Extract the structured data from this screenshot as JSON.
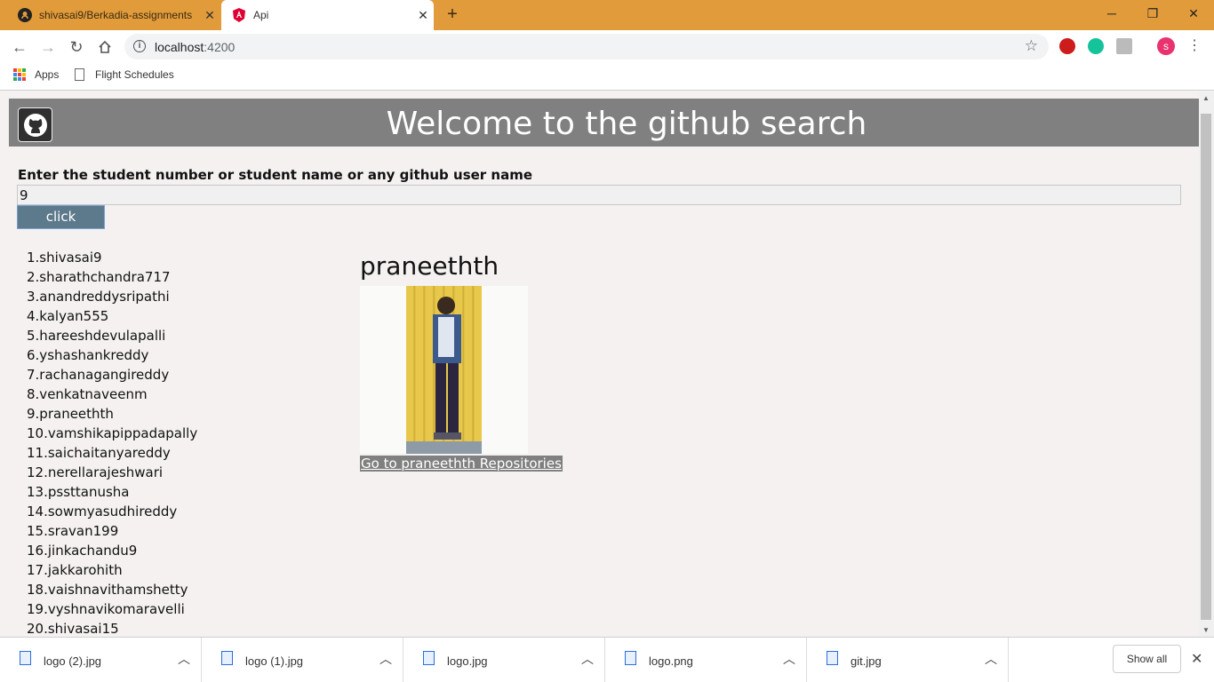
{
  "browser": {
    "tabs": [
      {
        "title": "shivasai9/Berkadia-assignments",
        "icon": "github-icon",
        "active": false
      },
      {
        "title": "Api",
        "icon": "angular-icon",
        "active": true
      }
    ],
    "new_tab": "+",
    "window_controls": {
      "minimize": "─",
      "restore": "❐",
      "close": "✕"
    },
    "url_host": "localhost",
    "url_port": ":4200",
    "profile_initial": "s",
    "bookmarks": [
      {
        "label": "Apps",
        "icon": "apps-grid-icon"
      },
      {
        "label": "Flight Schedules",
        "icon": "document-icon"
      }
    ]
  },
  "page": {
    "banner_title": "Welcome to the github search",
    "prompt_label": "Enter the student number or student name or any github user name",
    "search_value": "9",
    "button_label": "click",
    "students": [
      "1.shivasai9",
      "2.sharathchandra717",
      "3.anandreddysripathi",
      "4.kalyan555",
      "5.hareeshdevulapalli",
      "6.yshashankreddy",
      "7.rachanagangireddy",
      "8.venkatnaveenm",
      "9.praneethth",
      "10.vamshikapippadapally",
      "11.saichaitanyareddy",
      "12.nerellarajeshwari",
      "13.pssttanusha",
      "14.sowmyasudhireddy",
      "15.sravan199",
      "16.jinkachandu9",
      "17.jakkarohith",
      "18.vaishnavithamshetty",
      "19.vyshnavikomaravelli",
      "20.shivasai15"
    ],
    "user_name": "praneethth",
    "repo_link": "Go to praneethth Repositories"
  },
  "downloads": {
    "items": [
      {
        "name": "logo (2).jpg"
      },
      {
        "name": "logo (1).jpg"
      },
      {
        "name": "logo.jpg"
      },
      {
        "name": "logo.png"
      },
      {
        "name": "git.jpg"
      }
    ],
    "show_all": "Show all",
    "close": "✕"
  },
  "colors": {
    "tabstrip": "#e19b3b",
    "banner": "#808080",
    "button": "#5d7a8c",
    "page_bg": "#f4f1f0"
  }
}
